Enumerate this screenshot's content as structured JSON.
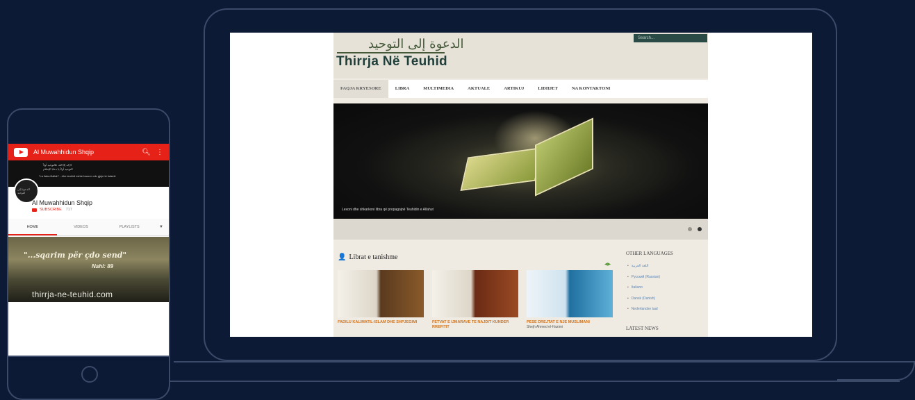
{
  "laptop": {
    "site": {
      "arabic_title": "الدعوة إلى التوحيد",
      "title": "Thirrja Në Teuhid",
      "search_placeholder": "Search...",
      "nav": [
        "FAQJA KRYESORE",
        "LIBRA",
        "MULTIMEDIA",
        "AKTUALE",
        "ARTIKUJ",
        "LIDHJET",
        "NA KONTAKTONI"
      ],
      "hero_caption": "Lexoni dhe shkarkoni libra që propagojnë Teuhidin e Allahut",
      "books_heading": "Librat e tanishme",
      "books": [
        {
          "title": "FADILU KALIMATIL-ISLAM DHE SHPJEGIMI",
          "subtitle": ""
        },
        {
          "title": "FETVAT E IJMARAVE TE NAJDIT KUNDER RREFITIT",
          "subtitle": ""
        },
        {
          "title": "PESE DREJTAT E NJE MUSLIMANI",
          "subtitle": "Shejh Ahmed el-Hazimi"
        }
      ],
      "sidebar": {
        "other_languages_heading": "OTHER LANGUAGES",
        "languages": [
          "اللغة العربية",
          "Русский (Russian)",
          "Italiano",
          "Dansk (Danish)",
          "Nederlandse taal"
        ],
        "latest_news_heading": "LATEST NEWS"
      }
    }
  },
  "phone": {
    "app_title": "Al Muwahhidun Shqip",
    "banner_text": "لا إله إلا الله  فالتوحيد أولاً\nالتوحيد أولاً يا دعاة الإسلام",
    "banner_text2": "\"La ilaha illallah\" - dhe teuhidi eshte baza e cdo gjeje te Islamit",
    "avatar_text": "الدعوة إلى التوحيد",
    "channel_name": "Al Muwahhidun Shqip",
    "subscribe_label": "SUBSCRIBE",
    "subscriber_count": "717",
    "tabs": [
      "HOME",
      "VIDEOS",
      "PLAYLISTS"
    ],
    "video_quote": "\"...sqarim për çdo send\"",
    "video_ref": "Nahl: 89",
    "video_url": "thirrja-ne-teuhid.com"
  },
  "colors": {
    "background": "#0d1a36",
    "frame": "#3c4a6a",
    "youtube_red": "#e62117",
    "site_title": "#213f3a",
    "book_label": "#d0731e"
  }
}
